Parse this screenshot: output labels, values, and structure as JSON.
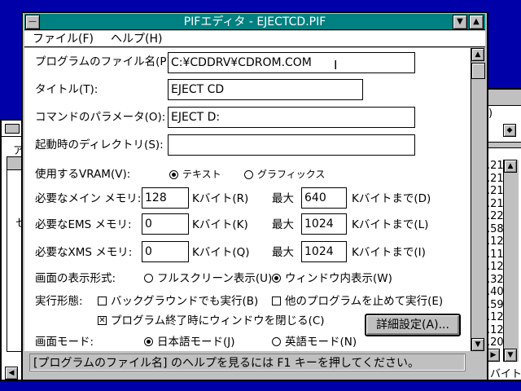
{
  "background_windows": {
    "left_window": {
      "menu_char": "ア",
      "body_char": "セ"
    },
    "right_window": {
      "top_fragment": ")",
      "numbers": [
        ".21",
        ".21",
        ".21",
        ".21",
        ".22",
        ".58",
        ".12",
        ".11",
        ".12",
        ".32",
        ".40",
        ".59",
        ".12",
        ".12",
        ".20"
      ],
      "bottom_fragment": "バイト"
    }
  },
  "window": {
    "title": "PIFエディタ - EJECTCD.PIF",
    "minimize_glyph": "▼",
    "maximize_glyph": "▲",
    "control_menu_glyph": "—"
  },
  "menubar": {
    "file": "ファイル(F)",
    "help": "ヘルプ(H)"
  },
  "form": {
    "program_filename_label": "プログラムのファイル名(P):",
    "program_filename_value": "C:¥CDDRV¥CDROM.COM",
    "title_label": "タイトル(T):",
    "title_value": "EJECT CD",
    "params_label": "コマンドのパラメータ(O):",
    "params_value": "EJECT D:",
    "startdir_label": "起動時のディレクトリ(S):",
    "startdir_value": "",
    "vram_label": "使用するVRAM(V):",
    "vram_text": "テキスト",
    "vram_graphics": "グラフィックス",
    "main_mem_label": "必要なメイン メモリ:",
    "main_mem_value": "128",
    "main_mem_unit": "Kバイト(R)",
    "main_mem_max_label": "最大",
    "main_mem_max_value": "640",
    "main_mem_max_unit": "Kバイトまで(D)",
    "ems_label": "必要なEMS メモリ:",
    "ems_value": "0",
    "ems_unit": "Kバイト(K)",
    "ems_max_label": "最大",
    "ems_max_value": "1024",
    "ems_max_unit": "Kバイトまで(L)",
    "xms_label": "必要なXMS メモリ:",
    "xms_value": "0",
    "xms_unit": "Kバイト(Q)",
    "xms_max_label": "最大",
    "xms_max_value": "1024",
    "xms_max_unit": "Kバイトまで(I)",
    "display_label": "画面の表示形式:",
    "display_fullscreen": "フルスクリーン表示(U)",
    "display_window": "ウィンドウ内表示(W)",
    "exec_label": "実行形態:",
    "exec_background": "バックグラウンドでも実行(B)",
    "exec_exclusive": "他のプログラムを止めて実行(E)",
    "close_on_exit": "プログラム終了時にウィンドウを閉じる(C)",
    "advanced_button": "詳細設定(A)...",
    "screen_mode_label": "画面モード:",
    "screen_mode_japanese": "日本語モード(J)",
    "screen_mode_english": "英語モード(N)"
  },
  "status": {
    "text": "[プログラムのファイル名] のヘルプを見るには F1 キーを押してください。"
  },
  "state": {
    "vram": "text",
    "display": "window",
    "exec_background_checked": false,
    "exec_exclusive_checked": false,
    "close_on_exit_checked": true,
    "screen_mode": "japanese"
  },
  "colors": {
    "desktop": "#0000a8",
    "titlebar": "#008080",
    "face": "#c0c0c0"
  }
}
